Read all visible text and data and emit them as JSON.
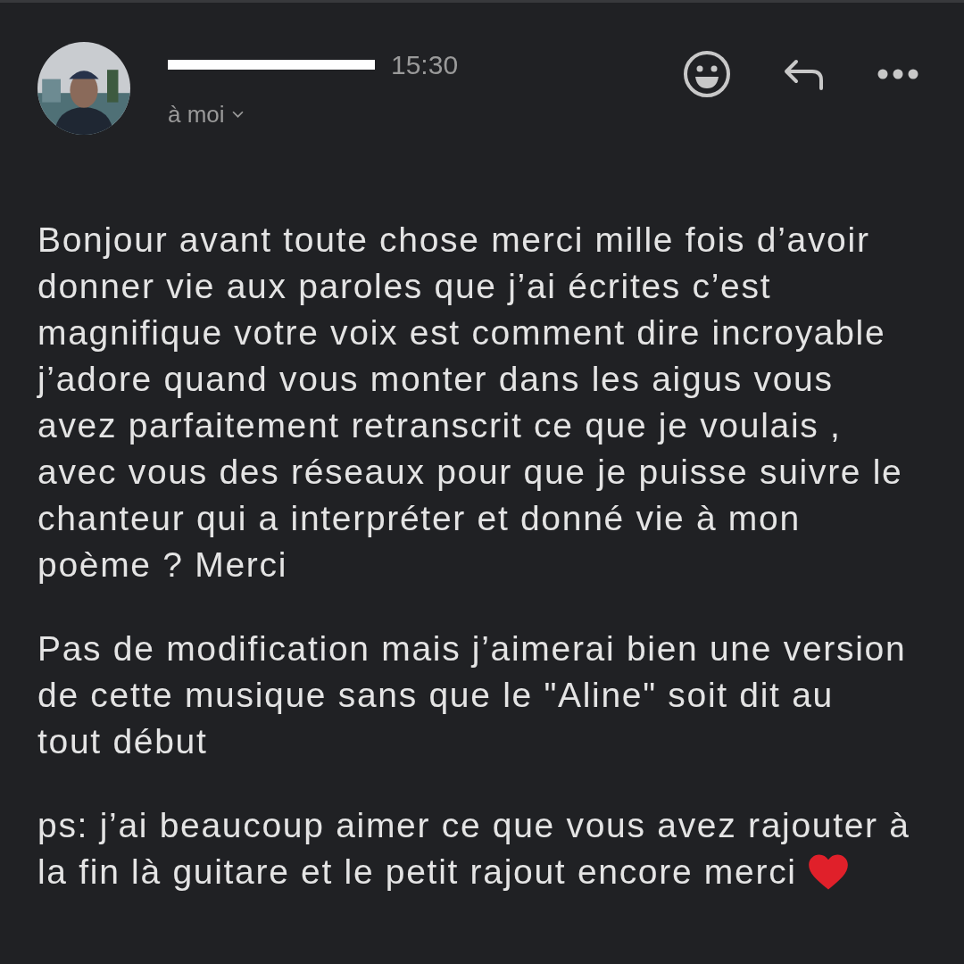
{
  "message": {
    "sender_redacted": true,
    "time": "15:30",
    "recipient": "à moi",
    "actions": [
      {
        "kind": "emoji"
      },
      {
        "kind": "reply"
      },
      {
        "kind": "more"
      }
    ],
    "paragraphs": [
      {
        "text": "Bonjour avant toute chose merci mille fois d’avoir\ndonner vie aux paroles que j’ai écrites c’est\nmagnifique votre voix est comment dire incroyable\nj’adore quand vous monter dans les aigus vous\navez parfaitement retranscrit ce que je voulais ,\navec vous des réseaux pour que je puisse suivre le\nchanteur qui a interpréter et donné vie à mon\npoème ? Merci",
        "heart": false
      },
      {
        "text": "Pas de modification mais j’aimerai bien une version\nde cette musique sans que le \"Aline\" soit dit au\ntout début",
        "heart": false
      },
      {
        "text": "ps: j’ai beaucoup aimer ce que vous avez rajouter à\nla fin là guitare et le petit rajout encore merci",
        "heart": true
      }
    ]
  }
}
